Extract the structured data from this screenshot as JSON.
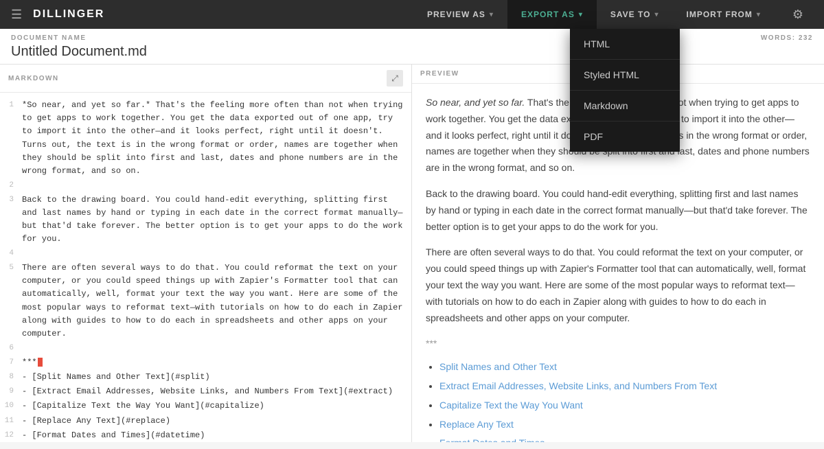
{
  "header": {
    "menu_icon": "☰",
    "logo": "DILLINGER",
    "nav": [
      {
        "id": "preview-as",
        "label": "PREVIEW AS",
        "active": false,
        "has_chevron": true
      },
      {
        "id": "export-as",
        "label": "EXPORT AS",
        "active": true,
        "has_chevron": true
      },
      {
        "id": "save-to",
        "label": "SAVE TO",
        "active": false,
        "has_chevron": true
      },
      {
        "id": "import-from",
        "label": "IMPORT FROM",
        "active": false,
        "has_chevron": true
      }
    ],
    "settings_icon": "⚙"
  },
  "document": {
    "label": "DOCUMENT NAME",
    "name": "Untitled Document.md",
    "words_label": "WORDS:",
    "words_count": "232"
  },
  "markdown_pane": {
    "label": "MARKDOWN",
    "expand_icon": "⤢",
    "lines": [
      {
        "num": 1,
        "content": "*So near, and yet so far.* That's the feeling more often than not when trying to get apps to work together. You get the data exported out of one app, try to import it into the other—and it looks perfect, right until it doesn't. Turns out, the text is in the wrong format or order, names are together when they should be split into first and last, dates and phone numbers are in the wrong format, and so on."
      },
      {
        "num": 2,
        "content": ""
      },
      {
        "num": 3,
        "content": "Back to the drawing board. You could hand-edit everything, splitting first and last names by hand or typing in each date in the correct format manually—but that'd take forever. The better option is to get your apps to do the work for you."
      },
      {
        "num": 4,
        "content": ""
      },
      {
        "num": 5,
        "content": "There are often several ways to do that. You could reformat the text on your computer, or you could speed things up with Zapier's Formatter tool that can automatically, well, format your text the way you want. Here are some of the most popular ways to reformat text—with tutorials on how to do each in Zapier along with guides to how to do each in spreadsheets and other apps on your computer."
      },
      {
        "num": 6,
        "content": ""
      },
      {
        "num": 7,
        "content": "***▊"
      },
      {
        "num": 8,
        "content": "- [Split Names and Other Text](#split)"
      },
      {
        "num": 9,
        "content": "- [Extract Email Addresses, Website Links, and Numbers From Text](#extract)"
      },
      {
        "num": 10,
        "content": "- [Capitalize Text the Way You Want](#capitalize)"
      },
      {
        "num": 11,
        "content": "- [Replace Any Text](#replace)"
      },
      {
        "num": 12,
        "content": "- [Format Dates and Times](#datetime)"
      }
    ]
  },
  "preview_pane": {
    "label": "PREVIEW",
    "paragraphs": [
      "So near, and yet so far. That's the feeling more often than not when trying to get apps to work together. You get the data exported out of one app, try to import it into the other—and it looks perfect, right until it doesn't. Turns out, the text is in the wrong format or order, names are together when they should be split into first and last, dates and phone numbers are in the wrong format, and so on.",
      "Back to the drawing board. You could hand-edit everything, splitting first and last names by hand or typing in each date in the correct format manually—but that'd take forever. The better option is to get your apps to do the work for you.",
      "There are often several ways to do that. You could reformat the text on your computer, or you could speed things up with Zapier's Formatter tool that can automatically, well, format your text the way you want. Here are some of the most popular ways to reformat text—with tutorials on how to do each in Zapier along with guides to how to do each in spreadsheets and other apps on your computer."
    ],
    "hr": "***",
    "links": [
      "Split Names and Other Text",
      "Extract Email Addresses, Website Links, and Numbers From Text",
      "Capitalize Text the Way You Want",
      "Replace Any Text",
      "Format Dates and Times"
    ]
  },
  "export_dropdown": {
    "items": [
      {
        "id": "html",
        "label": "HTML"
      },
      {
        "id": "styled-html",
        "label": "Styled HTML"
      },
      {
        "id": "markdown",
        "label": "Markdown"
      },
      {
        "id": "pdf",
        "label": "PDF"
      }
    ]
  },
  "colors": {
    "accent": "#4caf93",
    "link": "#5b9bd5",
    "dark_bg": "#2d2d2d",
    "darker_bg": "#1a1a1a"
  }
}
